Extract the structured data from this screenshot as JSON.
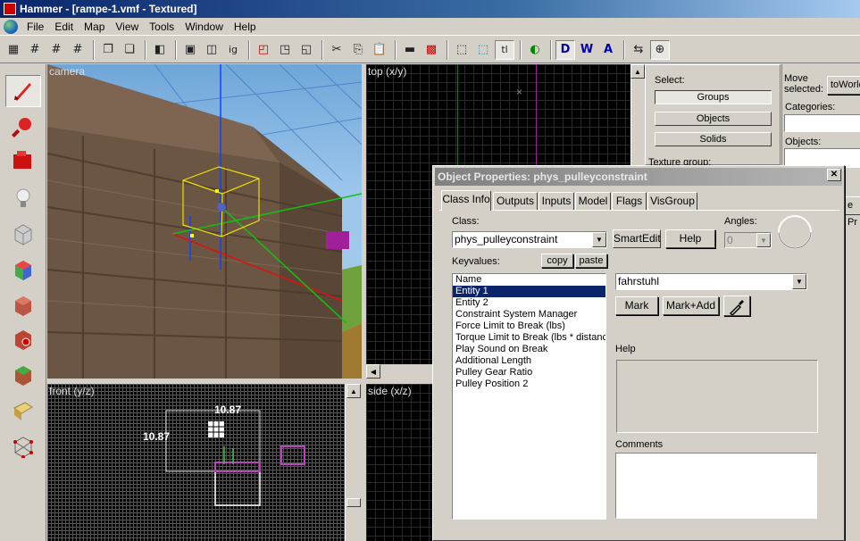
{
  "window": {
    "title": "Hammer - [rampe-1.vmf - Textured]"
  },
  "menu": [
    "File",
    "Edit",
    "Map",
    "View",
    "Tools",
    "Window",
    "Help"
  ],
  "toolbar": {
    "selected_label": "tl"
  },
  "viewports": {
    "camera": "camera",
    "top": "top (x/y)",
    "front": "front (y/z)",
    "side": "side (x/z)",
    "front_dim_h": "10.87",
    "front_dim_v": "10.87"
  },
  "right_panel": {
    "select_label": "Select:",
    "groups": "Groups",
    "objects_btn": "Objects",
    "solids": "Solids",
    "move_selected": "Move selected:",
    "to_world": "toWorld",
    "categories": "Categories:",
    "objects_label": "Objects:",
    "texture_group": "Texture group:",
    "prefab_partial": "e Pr"
  },
  "dialog": {
    "title": "Object Properties: phys_pulleyconstraint",
    "tabs": [
      "Class Info",
      "Outputs",
      "Inputs",
      "Model",
      "Flags",
      "VisGroup"
    ],
    "class_label": "Class:",
    "class_value": "phys_pulleyconstraint",
    "smartedit": "SmartEdit",
    "help_btn": "Help",
    "angles_label": "Angles:",
    "angles_value": "0",
    "keyvalues_label": "Keyvalues:",
    "copy": "copy",
    "paste": "paste",
    "keyvalues": [
      "Name",
      "Entity 1",
      "Entity 2",
      "Constraint System Manager",
      "Force Limit to Break (lbs)",
      "Torque Limit to Break (lbs * distance)",
      "Play Sound on Break",
      "Additional Length",
      "Pulley Gear Ratio",
      "Pulley Position 2"
    ],
    "selected_index": 1,
    "value_field": "fahrstuhl",
    "mark": "Mark",
    "mark_add": "Mark+Add",
    "help_label": "Help",
    "comments_label": "Comments"
  }
}
